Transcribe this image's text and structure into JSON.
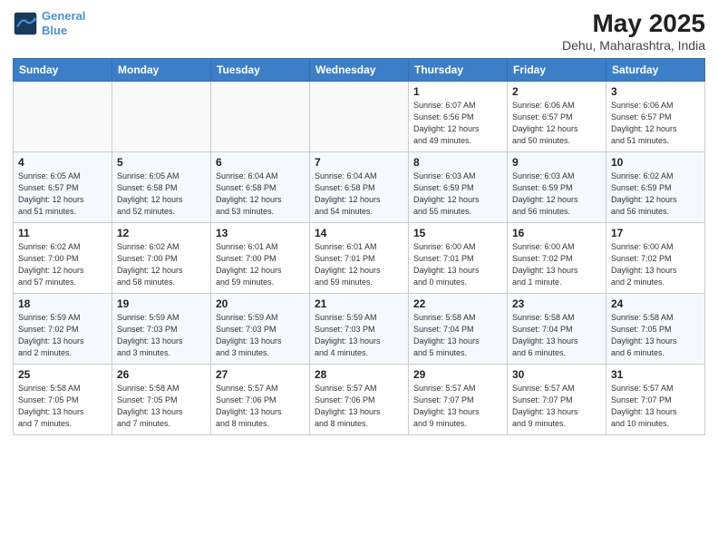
{
  "header": {
    "logo_line1": "General",
    "logo_line2": "Blue",
    "title": "May 2025",
    "subtitle": "Dehu, Maharashtra, India"
  },
  "weekdays": [
    "Sunday",
    "Monday",
    "Tuesday",
    "Wednesday",
    "Thursday",
    "Friday",
    "Saturday"
  ],
  "weeks": [
    [
      {
        "day": "",
        "info": ""
      },
      {
        "day": "",
        "info": ""
      },
      {
        "day": "",
        "info": ""
      },
      {
        "day": "",
        "info": ""
      },
      {
        "day": "1",
        "info": "Sunrise: 6:07 AM\nSunset: 6:56 PM\nDaylight: 12 hours\nand 49 minutes."
      },
      {
        "day": "2",
        "info": "Sunrise: 6:06 AM\nSunset: 6:57 PM\nDaylight: 12 hours\nand 50 minutes."
      },
      {
        "day": "3",
        "info": "Sunrise: 6:06 AM\nSunset: 6:57 PM\nDaylight: 12 hours\nand 51 minutes."
      }
    ],
    [
      {
        "day": "4",
        "info": "Sunrise: 6:05 AM\nSunset: 6:57 PM\nDaylight: 12 hours\nand 51 minutes."
      },
      {
        "day": "5",
        "info": "Sunrise: 6:05 AM\nSunset: 6:58 PM\nDaylight: 12 hours\nand 52 minutes."
      },
      {
        "day": "6",
        "info": "Sunrise: 6:04 AM\nSunset: 6:58 PM\nDaylight: 12 hours\nand 53 minutes."
      },
      {
        "day": "7",
        "info": "Sunrise: 6:04 AM\nSunset: 6:58 PM\nDaylight: 12 hours\nand 54 minutes."
      },
      {
        "day": "8",
        "info": "Sunrise: 6:03 AM\nSunset: 6:59 PM\nDaylight: 12 hours\nand 55 minutes."
      },
      {
        "day": "9",
        "info": "Sunrise: 6:03 AM\nSunset: 6:59 PM\nDaylight: 12 hours\nand 56 minutes."
      },
      {
        "day": "10",
        "info": "Sunrise: 6:02 AM\nSunset: 6:59 PM\nDaylight: 12 hours\nand 56 minutes."
      }
    ],
    [
      {
        "day": "11",
        "info": "Sunrise: 6:02 AM\nSunset: 7:00 PM\nDaylight: 12 hours\nand 57 minutes."
      },
      {
        "day": "12",
        "info": "Sunrise: 6:02 AM\nSunset: 7:00 PM\nDaylight: 12 hours\nand 58 minutes."
      },
      {
        "day": "13",
        "info": "Sunrise: 6:01 AM\nSunset: 7:00 PM\nDaylight: 12 hours\nand 59 minutes."
      },
      {
        "day": "14",
        "info": "Sunrise: 6:01 AM\nSunset: 7:01 PM\nDaylight: 12 hours\nand 59 minutes."
      },
      {
        "day": "15",
        "info": "Sunrise: 6:00 AM\nSunset: 7:01 PM\nDaylight: 13 hours\nand 0 minutes."
      },
      {
        "day": "16",
        "info": "Sunrise: 6:00 AM\nSunset: 7:02 PM\nDaylight: 13 hours\nand 1 minute."
      },
      {
        "day": "17",
        "info": "Sunrise: 6:00 AM\nSunset: 7:02 PM\nDaylight: 13 hours\nand 2 minutes."
      }
    ],
    [
      {
        "day": "18",
        "info": "Sunrise: 5:59 AM\nSunset: 7:02 PM\nDaylight: 13 hours\nand 2 minutes."
      },
      {
        "day": "19",
        "info": "Sunrise: 5:59 AM\nSunset: 7:03 PM\nDaylight: 13 hours\nand 3 minutes."
      },
      {
        "day": "20",
        "info": "Sunrise: 5:59 AM\nSunset: 7:03 PM\nDaylight: 13 hours\nand 3 minutes."
      },
      {
        "day": "21",
        "info": "Sunrise: 5:59 AM\nSunset: 7:03 PM\nDaylight: 13 hours\nand 4 minutes."
      },
      {
        "day": "22",
        "info": "Sunrise: 5:58 AM\nSunset: 7:04 PM\nDaylight: 13 hours\nand 5 minutes."
      },
      {
        "day": "23",
        "info": "Sunrise: 5:58 AM\nSunset: 7:04 PM\nDaylight: 13 hours\nand 6 minutes."
      },
      {
        "day": "24",
        "info": "Sunrise: 5:58 AM\nSunset: 7:05 PM\nDaylight: 13 hours\nand 6 minutes."
      }
    ],
    [
      {
        "day": "25",
        "info": "Sunrise: 5:58 AM\nSunset: 7:05 PM\nDaylight: 13 hours\nand 7 minutes."
      },
      {
        "day": "26",
        "info": "Sunrise: 5:58 AM\nSunset: 7:05 PM\nDaylight: 13 hours\nand 7 minutes."
      },
      {
        "day": "27",
        "info": "Sunrise: 5:57 AM\nSunset: 7:06 PM\nDaylight: 13 hours\nand 8 minutes."
      },
      {
        "day": "28",
        "info": "Sunrise: 5:57 AM\nSunset: 7:06 PM\nDaylight: 13 hours\nand 8 minutes."
      },
      {
        "day": "29",
        "info": "Sunrise: 5:57 AM\nSunset: 7:07 PM\nDaylight: 13 hours\nand 9 minutes."
      },
      {
        "day": "30",
        "info": "Sunrise: 5:57 AM\nSunset: 7:07 PM\nDaylight: 13 hours\nand 9 minutes."
      },
      {
        "day": "31",
        "info": "Sunrise: 5:57 AM\nSunset: 7:07 PM\nDaylight: 13 hours\nand 10 minutes."
      }
    ]
  ]
}
